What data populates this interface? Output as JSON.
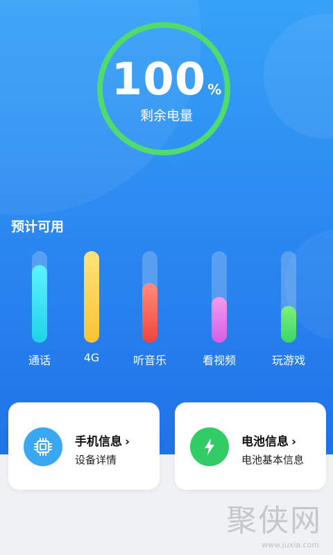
{
  "battery": {
    "percent": "100",
    "percent_sign": "%",
    "label": "剩余电量",
    "ring_color": "#4fdb6d"
  },
  "estimate": {
    "title": "预计可用",
    "items": [
      {
        "label": "通话",
        "level": 0.85,
        "color_top": "#5cf2ff",
        "color_bottom": "#1fd3e8"
      },
      {
        "label": "4G",
        "level": 1.0,
        "color_top": "#ffe27a",
        "color_bottom": "#f5c431"
      },
      {
        "label": "听音乐",
        "level": 0.65,
        "color_top": "#ff8c7a",
        "color_bottom": "#f0443c"
      },
      {
        "label": "看视频",
        "level": 0.5,
        "color_top": "#f29bf0",
        "color_bottom": "#d65ee6"
      },
      {
        "label": "玩游戏",
        "level": 0.4,
        "color_top": "#7ef07a",
        "color_bottom": "#3bd56a"
      }
    ]
  },
  "cards": [
    {
      "title": "手机信息",
      "chevron": "›",
      "subtitle": "设备详情",
      "icon": "chip-icon",
      "icon_color": "#3aa7f3"
    },
    {
      "title": "电池信息",
      "chevron": "›",
      "subtitle": "电池基本信息",
      "icon": "bolt-icon",
      "icon_color": "#32cc66"
    }
  ],
  "watermark": {
    "text": "聚侠网",
    "url": "www.juxia.com"
  }
}
